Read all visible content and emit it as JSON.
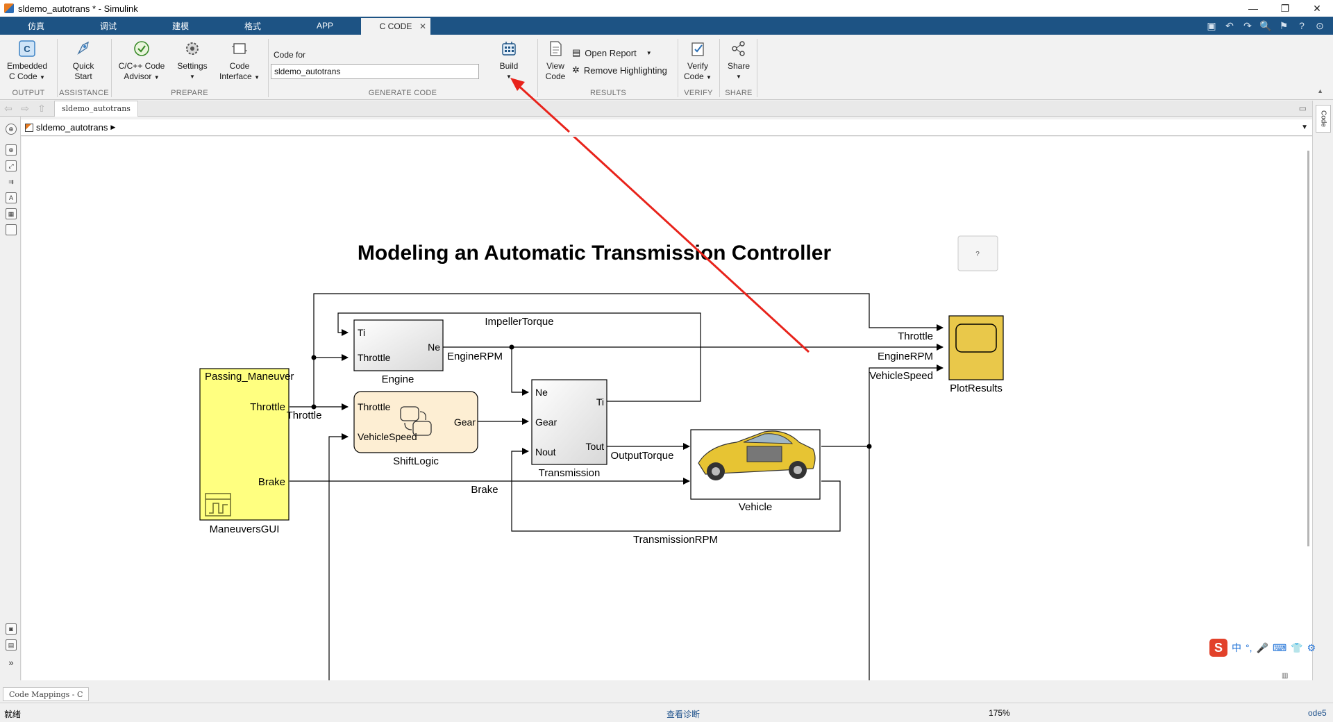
{
  "window": {
    "title": "sldemo_autotrans * - Simulink",
    "controls": [
      "—",
      "❐",
      "✕"
    ]
  },
  "tabs": [
    {
      "label": "仿真"
    },
    {
      "label": "调试"
    },
    {
      "label": "建模"
    },
    {
      "label": "格式"
    },
    {
      "label": "APP"
    },
    {
      "label": "C CODE",
      "active": true
    }
  ],
  "ribbon": {
    "embedded": {
      "line1": "Embedded",
      "line2": "C Code"
    },
    "quick_start": {
      "line1": "Quick",
      "line2": "Start"
    },
    "advisor": {
      "line1": "C/C++ Code",
      "line2": "Advisor"
    },
    "settings": {
      "line1": "Settings"
    },
    "code_interface": {
      "line1": "Code",
      "line2": "Interface"
    },
    "code_for_label": "Code for",
    "code_for_value": "sldemo_autotrans",
    "build": {
      "line1": "Build"
    },
    "view_code": {
      "line1": "View",
      "line2": "Code"
    },
    "open_report": "Open Report",
    "remove_highlighting": "Remove Highlighting",
    "verify": {
      "line1": "Verify",
      "line2": "Code"
    },
    "share": {
      "line1": "Share"
    },
    "sections": {
      "output": "OUTPUT",
      "assistance": "ASSISTANCE",
      "prepare": "PREPARE",
      "generate": "GENERATE CODE",
      "results": "RESULTS",
      "verify": "VERIFY",
      "share": "SHARE"
    }
  },
  "model_tab": "sldemo_autotrans",
  "breadcrumb": "sldemo_autotrans",
  "diagram": {
    "title": "Modeling an Automatic Transmission Controller",
    "help_button": "?",
    "blocks": {
      "maneuvers": {
        "name": "ManeuversGUI",
        "header": "Passing_Maneuver",
        "ports": [
          "Throttle",
          "Brake"
        ]
      },
      "engine": {
        "name": "Engine",
        "inputs": [
          "Ti",
          "Throttle"
        ],
        "output": "Ne"
      },
      "shiftlogic": {
        "name": "ShiftLogic",
        "inputs": [
          "Throttle",
          "VehicleSpeed"
        ],
        "output": "Gear"
      },
      "transmission": {
        "name": "Transmission",
        "inputs": [
          "Ne",
          "Gear",
          "Nout"
        ],
        "outputs": [
          "Ti",
          "Tout"
        ]
      },
      "vehicle": {
        "name": "Vehicle"
      },
      "plotresults": {
        "name": "PlotResults"
      }
    },
    "signals": {
      "impeller": "ImpellerTorque",
      "engine_rpm": "EngineRPM",
      "throttle": "Throttle",
      "output_torque": "OutputTorque",
      "brake": "Brake",
      "trans_rpm": "TransmissionRPM",
      "plot_throttle": "Throttle",
      "plot_engine_rpm": "EngineRPM",
      "plot_vehicle_speed": "VehicleSpeed"
    }
  },
  "bottom": {
    "mapping_tab": "Code Mappings - C",
    "status_left": "就绪",
    "status_center": "查看诊断",
    "zoom": "175%",
    "solver": "ode5"
  },
  "ime": {
    "logo": "S",
    "items": [
      "中",
      "°,",
      "🎤",
      "⌨",
      "👕",
      "⚙"
    ]
  },
  "colors": {
    "tabstrip": "#1d5384",
    "annotation_arrow": "#e8231b",
    "maneuvers_fill": "#ffff80",
    "plot_fill": "#e9c84a",
    "shiftlogic_fill": "#fdeed3"
  }
}
